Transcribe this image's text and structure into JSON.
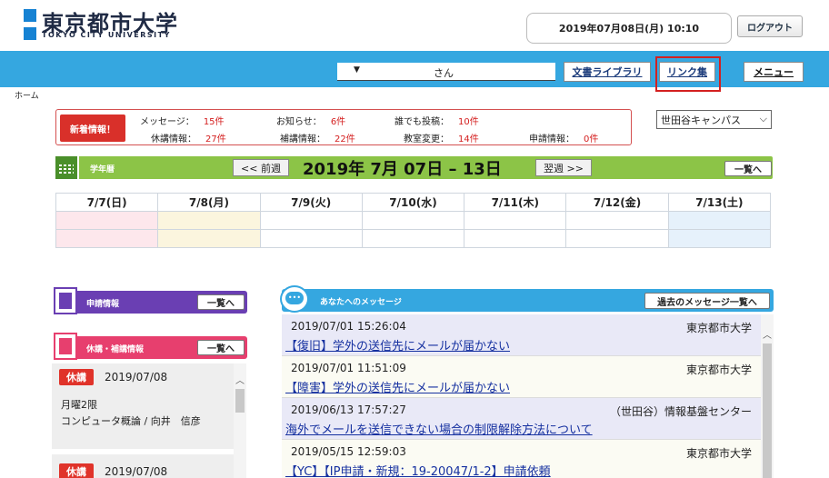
{
  "header": {
    "logo_jp": "東京都市大学",
    "logo_en": "TOKYO CITY UNIVERSITY",
    "datetime": "2019年07月08日(月) 10:10",
    "logout": "ログアウト"
  },
  "nav": {
    "user_arrow": "▼",
    "user_suffix": "さん",
    "library": "文書ライブラリ",
    "links": "リンク集",
    "menu": "メニュー"
  },
  "breadcrumb": "ホーム",
  "news": {
    "badge": "新着情報！",
    "items": [
      {
        "label": "メッセージ：",
        "count": "15件"
      },
      {
        "label": "お知らせ：",
        "count": "6件"
      },
      {
        "label": "誰でも投稿：",
        "count": "10件"
      },
      {
        "label": "休講情報：",
        "count": "27件"
      },
      {
        "label": "補講情報：",
        "count": "22件"
      },
      {
        "label": "教室変更：",
        "count": "14件"
      },
      {
        "label": "申請情報：",
        "count": "0件"
      }
    ]
  },
  "campus": {
    "selected": "世田谷キャンパス"
  },
  "schedule": {
    "label": "学年暦",
    "prev": "<< 前週",
    "title": "2019年 7月 07日 – 13日",
    "next": "翌週 >>",
    "list": "一覧へ",
    "days": [
      "7/7(日)",
      "7/8(月)",
      "7/9(火)",
      "7/10(水)",
      "7/11(木)",
      "7/12(金)",
      "7/13(土)"
    ]
  },
  "apply_panel": {
    "label": "申請情報",
    "list": "一覧へ"
  },
  "cancel_panel": {
    "label": "休講・補講情報",
    "list": "一覧へ",
    "items": [
      {
        "tag": "休講",
        "date": "2019/07/08",
        "line1": "月曜2限",
        "line2": "コンピュータ概論 / 向井　信彦"
      },
      {
        "tag": "休講",
        "date": "2019/07/08"
      }
    ]
  },
  "messages_panel": {
    "label": "あなたへのメッセージ",
    "past": "過去のメッセージ一覧へ",
    "items": [
      {
        "date": "2019/07/01 15:26:04",
        "from": "東京都市大学",
        "title": "【復旧】学外の送信先にメールが届かない"
      },
      {
        "date": "2019/07/01 11:51:09",
        "from": "東京都市大学",
        "title": "【障害】学外の送信先にメールが届かない"
      },
      {
        "date": "2019/06/13 17:57:27",
        "from": "（世田谷）情報基盤センター",
        "title": "海外でメールを送信できない場合の制限解除方法について"
      },
      {
        "date": "2019/05/15 12:59:03",
        "from": "東京都市大学",
        "title": "【YC】【IP申請・新規：19-20047/1-2】申請依頼"
      }
    ]
  },
  "colors": {
    "nav_blue": "#35a7e0",
    "schedule_green": "#8cc447",
    "apply_purple": "#6a3fb3",
    "cancel_pink": "#e73f6e",
    "alert_red": "#d42020"
  }
}
